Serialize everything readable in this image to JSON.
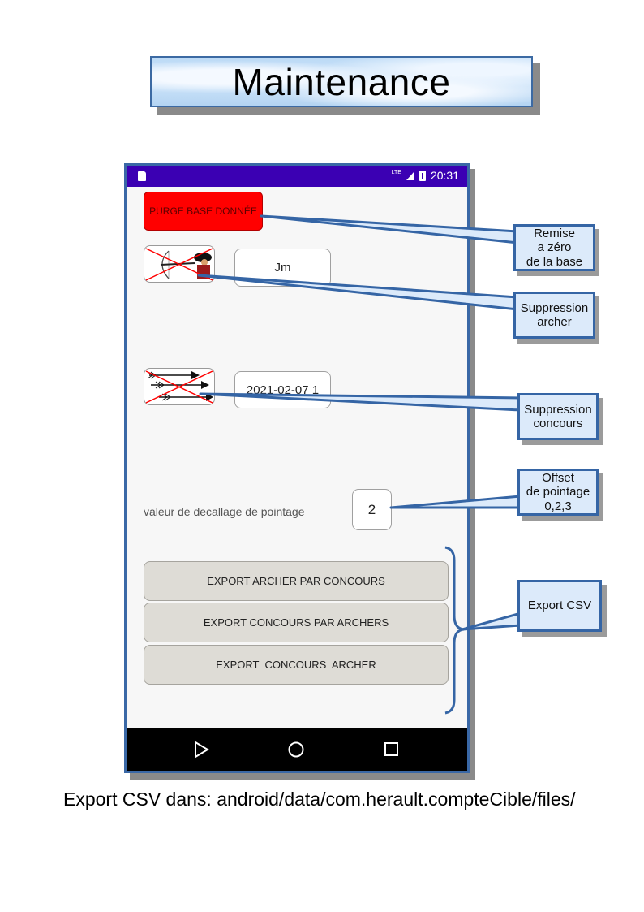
{
  "page": {
    "title": "Maintenance",
    "footer": "Export CSV dans: android/data/com.herault.compteCible/files/"
  },
  "phone": {
    "status_bar": {
      "network": "LTE",
      "time": "20:31"
    },
    "purge_button": "PURGE BASE DONNÉE",
    "archer_field": "Jm",
    "concours_field": "2021-02-07 1",
    "offset_label": "valeur de decallage de pointage",
    "offset_value": "2",
    "export_buttons": [
      "EXPORT ARCHER PAR CONCOURS",
      "EXPORT CONCOURS PAR ARCHERS",
      "EXPORT  CONCOURS  ARCHER"
    ]
  },
  "callouts": {
    "remise": "Remise\na zéro\nde la base",
    "suppression_archer": "Suppression\narcher",
    "suppression_concours": "Suppression\nconcours",
    "offset": "Offset\nde pointage\n0,2,3",
    "export_csv": "Export CSV"
  },
  "colors": {
    "status_bar": "#3b00b3",
    "purge_button": "#ff0000",
    "callout_border": "#3565a5",
    "callout_fill": "#dceafa"
  }
}
